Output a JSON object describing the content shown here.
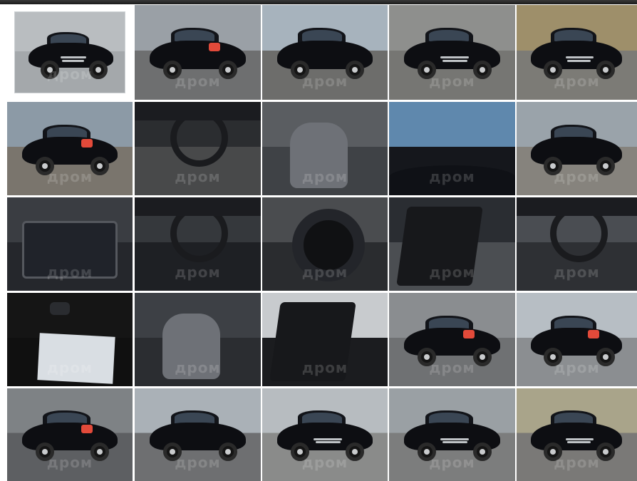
{
  "gallery": {
    "watermark": "дром",
    "selected_index": 0,
    "photos": [
      {
        "kind": "exterior-front",
        "bg": "#b9bdc0",
        "ground": "#a4a8ab",
        "scene": "front"
      },
      {
        "kind": "exterior-rear",
        "bg": "#9aa0a6",
        "ground": "#6e6f70",
        "scene": "rear"
      },
      {
        "kind": "exterior-side",
        "bg": "#a7b3bd",
        "ground": "#6d6d6b",
        "scene": "side"
      },
      {
        "kind": "exterior-front",
        "bg": "#8e8f8d",
        "ground": "#767673",
        "scene": "front"
      },
      {
        "kind": "exterior-front",
        "bg": "#9e8f6a",
        "ground": "#7c7b76",
        "scene": "front"
      },
      {
        "kind": "exterior-rear",
        "bg": "#8c9aa6",
        "ground": "#7a756d",
        "scene": "rear"
      },
      {
        "kind": "interior-steering",
        "bg": "#2b2d30",
        "ground": "#48494a",
        "scene": "interior"
      },
      {
        "kind": "interior-seats",
        "bg": "#5a5d61",
        "ground": "#3f4246",
        "scene": "seats"
      },
      {
        "kind": "windshield-sky",
        "bg": "#5f88ad",
        "ground": "#15171c",
        "scene": "sky"
      },
      {
        "kind": "exterior-side",
        "bg": "#9aa3aa",
        "ground": "#86837d",
        "scene": "side"
      },
      {
        "kind": "trunk",
        "bg": "#3a3d42",
        "ground": "#25272c",
        "scene": "trunk"
      },
      {
        "kind": "center-console",
        "bg": "#35383c",
        "ground": "#1e2024",
        "scene": "console"
      },
      {
        "kind": "spare-wheel",
        "bg": "#4a4c4f",
        "ground": "#2a2c2f",
        "scene": "spare"
      },
      {
        "kind": "door-interior",
        "bg": "#2a2d32",
        "ground": "#4b4e52",
        "scene": "door"
      },
      {
        "kind": "steering-wheel",
        "bg": "#4a4d52",
        "ground": "#2e3034",
        "scene": "interior"
      },
      {
        "kind": "keys-documents",
        "bg": "#151515",
        "ground": "#101010",
        "scene": "keys"
      },
      {
        "kind": "interior-seats",
        "bg": "#3d4045",
        "ground": "#2b2d31",
        "scene": "seats"
      },
      {
        "kind": "door-panel",
        "bg": "#c8cbce",
        "ground": "#1b1c1f",
        "scene": "door"
      },
      {
        "kind": "exterior-rear-corner",
        "bg": "#8a8d90",
        "ground": "#6f7173",
        "scene": "rear"
      },
      {
        "kind": "exterior-rear",
        "bg": "#b7bec4",
        "ground": "#8b8e91",
        "scene": "rear"
      },
      {
        "kind": "exterior-rear-corner",
        "bg": "#7e8285",
        "ground": "#5d5f62",
        "scene": "rear"
      },
      {
        "kind": "exterior-side",
        "bg": "#aab1b7",
        "ground": "#6e6f71",
        "scene": "side"
      },
      {
        "kind": "exterior-front",
        "bg": "#b7bcc0",
        "ground": "#8a8b8a",
        "scene": "front"
      },
      {
        "kind": "exterior-front",
        "bg": "#9aa0a4",
        "ground": "#7c7d7d",
        "scene": "front"
      },
      {
        "kind": "exterior-front",
        "bg": "#a9a48a",
        "ground": "#7a7977",
        "scene": "front"
      }
    ]
  }
}
